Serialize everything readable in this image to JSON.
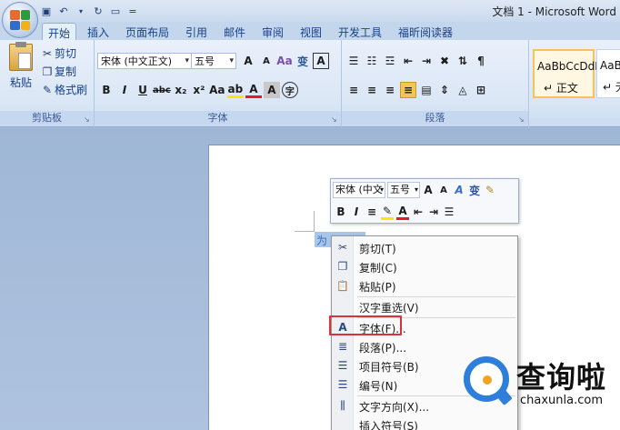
{
  "window": {
    "title": "文档 1 - Microsoft Word"
  },
  "quick_access": {
    "icons": [
      "save-icon",
      "undo-icon",
      "redo-icon",
      "print-preview-icon"
    ],
    "more": "="
  },
  "tabs": [
    {
      "label": "开始",
      "active": true
    },
    {
      "label": "插入"
    },
    {
      "label": "页面布局"
    },
    {
      "label": "引用"
    },
    {
      "label": "邮件"
    },
    {
      "label": "审阅"
    },
    {
      "label": "视图"
    },
    {
      "label": "开发工具"
    },
    {
      "label": "福昕阅读器"
    }
  ],
  "ribbon": {
    "clipboard": {
      "label": "剪贴板",
      "paste": "粘贴",
      "cut": "剪切",
      "copy": "复制",
      "format_painter": "格式刷"
    },
    "font": {
      "label": "字体",
      "font_name": "宋体 (中文正文)",
      "font_size": "五号",
      "tools_row1": [
        "A",
        "A",
        "Aa",
        "变",
        "A"
      ],
      "tools_row2": [
        "B",
        "I",
        "U",
        "abc",
        "x₂",
        "x²",
        "Aa",
        "ab",
        "A",
        "A",
        "字"
      ]
    },
    "paragraph": {
      "label": "段落"
    },
    "styles": {
      "sample1": "AaBbCcDdI",
      "name1": "↵ 正文",
      "sample2": "AaBb",
      "name2": "↵ 无"
    }
  },
  "document": {
    "selected_text": "为"
  },
  "mini_toolbar": {
    "font_name": "宋体 (中文",
    "font_size": "五号",
    "row1": [
      "A",
      "A",
      "A",
      "变",
      "✎"
    ],
    "row2": [
      "B",
      "I",
      "≡",
      "✎",
      "A",
      "⇤",
      "⇥",
      "☰"
    ]
  },
  "context_menu": {
    "items": [
      {
        "label": "剪切(T)",
        "icon": "scissors-icon",
        "glyph": "✂"
      },
      {
        "label": "复制(C)",
        "icon": "copy-icon",
        "glyph": "❐"
      },
      {
        "label": "粘贴(P)",
        "icon": "paste-icon",
        "glyph": "📋"
      },
      {
        "label": "汉字重选(V)",
        "icon": "",
        "glyph": ""
      },
      {
        "label": "字体(F)...",
        "icon": "font-icon",
        "glyph": "A"
      },
      {
        "label": "段落(P)...",
        "icon": "paragraph-icon",
        "glyph": "≣"
      },
      {
        "label": "项目符号(B)",
        "icon": "bullets-icon",
        "glyph": "☰"
      },
      {
        "label": "编号(N)",
        "icon": "numbering-icon",
        "glyph": "☰"
      },
      {
        "label": "文字方向(X)...",
        "icon": "text-direction-icon",
        "glyph": "⫼"
      },
      {
        "label": "插入符号(S)",
        "icon": "",
        "glyph": ""
      }
    ]
  },
  "watermark": {
    "cn": "查询啦",
    "en": "chaxunla.com"
  },
  "colors": {
    "highlight_box": "#d6343a",
    "ribbon_bg": "#dbe7f6",
    "selection": "#a8c6ea"
  }
}
